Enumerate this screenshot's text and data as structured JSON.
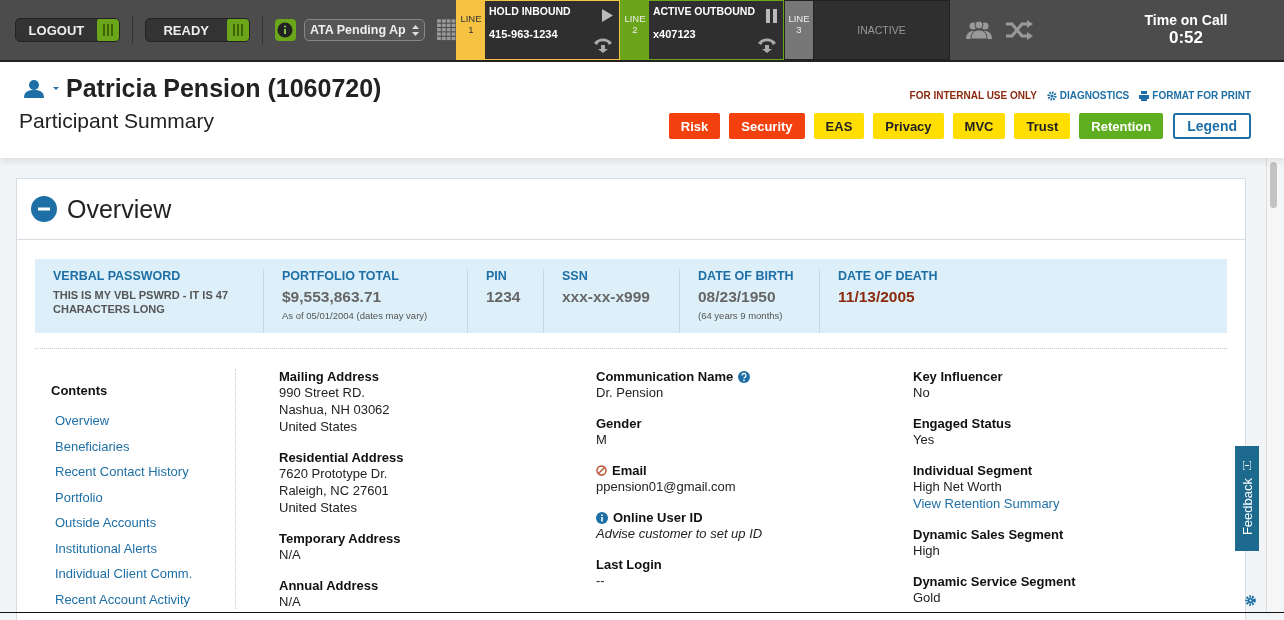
{
  "toolbar": {
    "buttons": [
      {
        "label": "LOGOUT"
      },
      {
        "label": "READY"
      }
    ],
    "queue": {
      "value": "ATA Pending Ap"
    }
  },
  "lines": [
    {
      "label": "LINE",
      "number": "1",
      "kind": "hold",
      "status": "HOLD INBOUND",
      "caller": "415-963-1234"
    },
    {
      "label": "LINE",
      "number": "2",
      "kind": "active",
      "status": "ACTIVE OUTBOUND",
      "caller": "x407123"
    },
    {
      "label": "LINE",
      "number": "3",
      "kind": "inactive",
      "status": "INACTIVE"
    }
  ],
  "time_on_call": {
    "label": "Time on Call",
    "value": "0:52"
  },
  "header": {
    "name": "Patricia Pension (1060720)",
    "subtitle": "Participant Summary",
    "notice": "FOR INTERNAL USE ONLY",
    "links": [
      "DIAGNOSTICS",
      "FORMAT FOR PRINT"
    ],
    "tags": [
      {
        "label": "Risk",
        "color": "#f2410f"
      },
      {
        "label": "Security",
        "color": "#f2410f"
      },
      {
        "label": "EAS",
        "color": "#ffde00"
      },
      {
        "label": "Privacy",
        "color": "#ffde00"
      },
      {
        "label": "MVC",
        "color": "#ffde00"
      },
      {
        "label": "Trust",
        "color": "#ffde00"
      },
      {
        "label": "Retention",
        "color": "#5fae1f"
      }
    ],
    "legend": "Legend"
  },
  "overview": {
    "title": "Overview",
    "expanded": true,
    "summary": [
      {
        "label": "VERBAL PASSWORD",
        "value": "THIS IS MY VBL PSWRD - IT IS 47 CHARACTERS LONG",
        "kind": "small",
        "alert": false
      },
      {
        "label": "PORTFOLIO TOTAL",
        "value": "$9,553,863.71",
        "note": "As of 05/01/2004 (dates may vary)",
        "kind": "large",
        "alert": false
      },
      {
        "label": "PIN",
        "value": "1234",
        "kind": "large",
        "alert": false
      },
      {
        "label": "SSN",
        "value": "xxx-xx-x999",
        "kind": "large",
        "alert": false
      },
      {
        "label": "DATE OF BIRTH",
        "value": "08/23/1950",
        "note": "(64 years 9 months)",
        "kind": "large",
        "alert": false
      },
      {
        "label": "DATE OF DEATH",
        "value": "11/13/2005",
        "kind": "large",
        "alert": true
      }
    ],
    "contents": {
      "title": "Contents",
      "items": [
        "Overview",
        "Beneficiaries",
        "Recent Contact History",
        "Portfolio",
        "Outside Accounts",
        "Institutional Alerts",
        "Individual Client Comm.",
        "Recent Account Activity"
      ]
    },
    "columns": [
      [
        {
          "label": "Mailing Address",
          "kind": "plain",
          "lines": [
            "990 Street RD.",
            "Nashua, NH 03062",
            "United States"
          ]
        },
        {
          "label": "Residential Address",
          "kind": "plain",
          "lines": [
            "7620 Prototype Dr.",
            "Raleigh, NC 27601",
            "United States"
          ]
        },
        {
          "label": "Temporary Address",
          "kind": "plain",
          "lines": [
            "N/A"
          ]
        },
        {
          "label": "Annual Address",
          "kind": "plain",
          "lines": [
            "N/A"
          ]
        }
      ],
      [
        {
          "label": "Communication Name",
          "kind": "help",
          "lines": [
            "Dr. Pension"
          ]
        },
        {
          "label": "Gender",
          "kind": "plain",
          "lines": [
            "M"
          ]
        },
        {
          "label": "Email",
          "kind": "blocked",
          "lines": [
            "ppension01@gmail.com"
          ]
        },
        {
          "label": "Online User ID",
          "kind": "info",
          "lines": [
            "Advise customer to set up ID"
          ]
        },
        {
          "label": "Last Login",
          "kind": "plain",
          "lines": [
            "--"
          ]
        }
      ],
      [
        {
          "label": "Key Influencer",
          "kind": "plain",
          "lines": [
            "No"
          ]
        },
        {
          "label": "Engaged Status",
          "kind": "plain",
          "lines": [
            "Yes"
          ]
        },
        {
          "label": "Individual Segment",
          "kind": "plain",
          "lines": [
            "High Net Worth"
          ],
          "link": "View Retention Summary"
        },
        {
          "label": "Dynamic Sales Segment",
          "kind": "plain",
          "lines": [
            "High"
          ]
        },
        {
          "label": "Dynamic Service Segment",
          "kind": "plain",
          "lines": [
            "Gold"
          ]
        }
      ]
    ]
  },
  "feedback": "Feedback"
}
